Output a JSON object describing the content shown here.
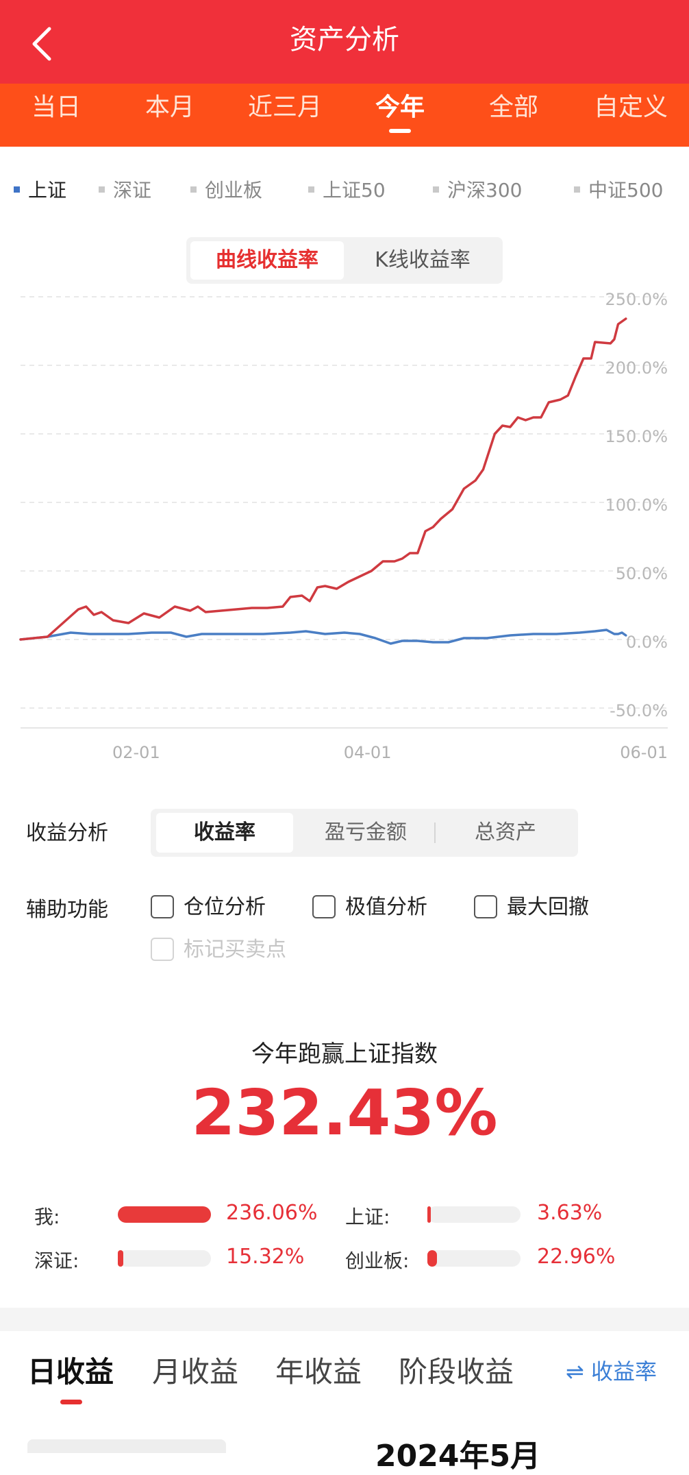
{
  "header": {
    "title": "资产分析"
  },
  "period_tabs": [
    {
      "label": "当日"
    },
    {
      "label": "本月"
    },
    {
      "label": "近三月"
    },
    {
      "label": "今年",
      "active": true
    },
    {
      "label": "全部"
    },
    {
      "label": "自定义"
    }
  ],
  "index_legend": [
    {
      "label": "上证",
      "active": true
    },
    {
      "label": "深证"
    },
    {
      "label": "创业板"
    },
    {
      "label": "上证50"
    },
    {
      "label": "沪深300"
    },
    {
      "label": "中证500"
    }
  ],
  "chart_modes": [
    {
      "label": "曲线收益率",
      "active": true
    },
    {
      "label": "K线收益率"
    }
  ],
  "chart_data": {
    "type": "line",
    "y_ticks": [
      "250.0%",
      "200.0%",
      "150.0%",
      "100.0%",
      "50.0%",
      "0.0%",
      "-50.0%"
    ],
    "ylim": [
      -50,
      250
    ],
    "x_ticks": [
      {
        "label": "02-01",
        "date": "2024-02-01"
      },
      {
        "label": "04-01",
        "date": "2024-04-01"
      },
      {
        "label": "06-01",
        "date": "2024-06-01"
      }
    ],
    "xlim": [
      "2024-01-02",
      "2024-06-01"
    ],
    "grid": true,
    "series": [
      {
        "color": "#cf3a40",
        "points": [
          [
            "2024-01-02",
            0
          ],
          [
            "2024-01-09",
            2
          ],
          [
            "2024-01-13",
            12
          ],
          [
            "2024-01-17",
            22
          ],
          [
            "2024-01-19",
            24
          ],
          [
            "2024-01-21",
            18
          ],
          [
            "2024-01-23",
            20
          ],
          [
            "2024-01-26",
            14
          ],
          [
            "2024-01-30",
            12
          ],
          [
            "2024-02-03",
            19
          ],
          [
            "2024-02-07",
            16
          ],
          [
            "2024-02-11",
            24
          ],
          [
            "2024-02-15",
            21
          ],
          [
            "2024-02-17",
            24
          ],
          [
            "2024-02-19",
            20
          ],
          [
            "2024-02-23",
            21
          ],
          [
            "2024-02-27",
            22
          ],
          [
            "2024-03-02",
            23
          ],
          [
            "2024-03-06",
            23
          ],
          [
            "2024-03-10",
            24
          ],
          [
            "2024-03-12",
            31
          ],
          [
            "2024-03-15",
            32
          ],
          [
            "2024-03-17",
            28
          ],
          [
            "2024-03-19",
            38
          ],
          [
            "2024-03-21",
            39
          ],
          [
            "2024-03-24",
            37
          ],
          [
            "2024-03-27",
            42
          ],
          [
            "2024-03-30",
            46
          ],
          [
            "2024-04-02",
            50
          ],
          [
            "2024-04-05",
            57
          ],
          [
            "2024-04-08",
            57
          ],
          [
            "2024-04-10",
            59
          ],
          [
            "2024-04-12",
            63
          ],
          [
            "2024-04-14",
            63
          ],
          [
            "2024-04-16",
            79
          ],
          [
            "2024-04-18",
            82
          ],
          [
            "2024-04-20",
            88
          ],
          [
            "2024-04-23",
            95
          ],
          [
            "2024-04-26",
            110
          ],
          [
            "2024-04-29",
            116
          ],
          [
            "2024-05-01",
            124
          ],
          [
            "2024-05-04",
            150
          ],
          [
            "2024-05-06",
            156
          ],
          [
            "2024-05-08",
            155
          ],
          [
            "2024-05-10",
            162
          ],
          [
            "2024-05-12",
            160
          ],
          [
            "2024-05-14",
            162
          ],
          [
            "2024-05-16",
            162
          ],
          [
            "2024-05-18",
            173
          ],
          [
            "2024-05-21",
            175
          ],
          [
            "2024-05-23",
            178
          ],
          [
            "2024-05-25",
            192
          ],
          [
            "2024-05-27",
            205
          ],
          [
            "2024-05-29",
            205
          ],
          [
            "2024-05-30",
            217
          ],
          [
            "2024-06-03",
            216
          ],
          [
            "2024-06-04",
            219
          ],
          [
            "2024-06-05",
            230
          ],
          [
            "2024-06-07",
            234
          ]
        ]
      },
      {
        "color": "#4a7ec4",
        "points": [
          [
            "2024-01-02",
            0
          ],
          [
            "2024-01-09",
            2
          ],
          [
            "2024-01-15",
            5
          ],
          [
            "2024-01-20",
            4
          ],
          [
            "2024-01-30",
            4
          ],
          [
            "2024-02-05",
            5
          ],
          [
            "2024-02-10",
            5
          ],
          [
            "2024-02-14",
            2
          ],
          [
            "2024-02-18",
            4
          ],
          [
            "2024-02-24",
            4
          ],
          [
            "2024-03-05",
            4
          ],
          [
            "2024-03-12",
            5
          ],
          [
            "2024-03-16",
            6
          ],
          [
            "2024-03-21",
            4
          ],
          [
            "2024-03-26",
            5
          ],
          [
            "2024-03-30",
            4
          ],
          [
            "2024-04-03",
            1
          ],
          [
            "2024-04-07",
            -3
          ],
          [
            "2024-04-10",
            -1
          ],
          [
            "2024-04-14",
            -1
          ],
          [
            "2024-04-18",
            -2
          ],
          [
            "2024-04-22",
            -2
          ],
          [
            "2024-04-26",
            1
          ],
          [
            "2024-05-02",
            1
          ],
          [
            "2024-05-08",
            3
          ],
          [
            "2024-05-14",
            4
          ],
          [
            "2024-05-20",
            4
          ],
          [
            "2024-05-26",
            5
          ],
          [
            "2024-05-30",
            6
          ],
          [
            "2024-06-02",
            7
          ],
          [
            "2024-06-04",
            4
          ],
          [
            "2024-06-05",
            4
          ],
          [
            "2024-06-06",
            5
          ],
          [
            "2024-06-07",
            3
          ]
        ]
      }
    ]
  },
  "analysis": {
    "label": "收益分析",
    "tabs": [
      {
        "label": "收益率",
        "active": true
      },
      {
        "label": "盈亏金额"
      },
      {
        "label": "总资产"
      }
    ]
  },
  "aux": {
    "label": "辅助功能",
    "options": [
      {
        "label": "仓位分析"
      },
      {
        "label": "极值分析"
      },
      {
        "label": "最大回撤"
      },
      {
        "label": "标记买卖点",
        "disabled": true
      }
    ]
  },
  "summary": {
    "title": "今年跑赢上证指数",
    "value": "232.43%",
    "comparisons": [
      {
        "label": "我:",
        "value": "236.06%",
        "fill": 1.0
      },
      {
        "label": "上证:",
        "value": "3.63%",
        "fill": 0.02
      },
      {
        "label": "深证:",
        "value": "15.32%",
        "fill": 0.06
      },
      {
        "label": "创业板:",
        "value": "22.96%",
        "fill": 0.1
      }
    ]
  },
  "bottom_tabs": [
    {
      "label": "日收益",
      "active": true
    },
    {
      "label": "月收益"
    },
    {
      "label": "年收益"
    },
    {
      "label": "阶段收益"
    }
  ],
  "bottom_toggle": {
    "icon": "swap-icon",
    "glyph": "⇌",
    "label": "收益率"
  },
  "peek_text": "2024年5月"
}
